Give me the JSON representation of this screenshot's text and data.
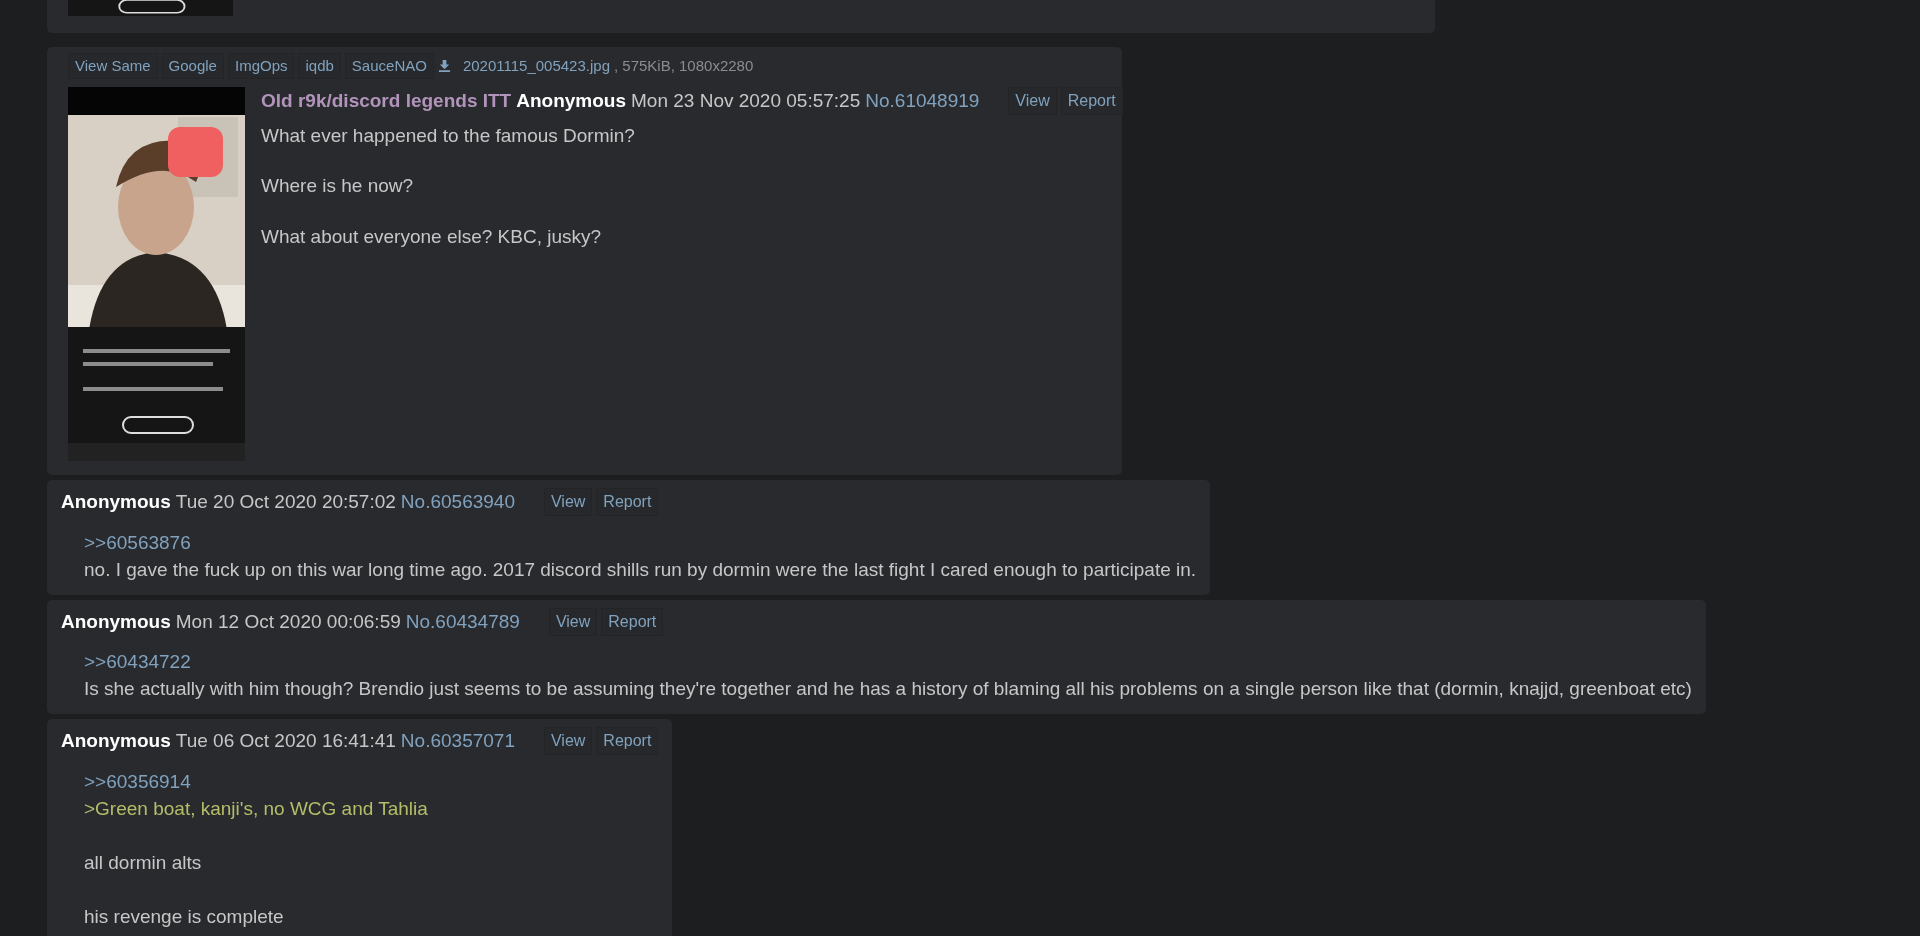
{
  "partial_post": {
    "thumbnail": {
      "kind": "picture"
    }
  },
  "op_post": {
    "image_links": [
      "View Same",
      "Google",
      "ImgOps",
      "iqdb",
      "SauceNAO"
    ],
    "file_name": "20201115_005423.jpg",
    "file_meta": ", 575KiB, 1080x2280",
    "thumbnail": {
      "kind": "picture"
    },
    "subject": "Old r9k/discord legends ITT",
    "name": "Anonymous",
    "date": "Mon 23 Nov 2020 05:57:25",
    "number": "No.61048919",
    "buttons": [
      "View",
      "Report"
    ],
    "paragraphs": [
      {
        "lines": [
          {
            "kind": "text",
            "text": "What ever happened to the famous Dormin?"
          }
        ]
      },
      {
        "lines": [
          {
            "kind": "text",
            "text": "Where is he now?"
          }
        ]
      },
      {
        "lines": [
          {
            "kind": "text",
            "text": "What about everyone else? KBC, jusky?"
          }
        ]
      }
    ]
  },
  "replies": [
    {
      "name": "Anonymous",
      "date": "Tue 20 Oct 2020 20:57:02",
      "number": "No.60563940",
      "buttons": [
        "View",
        "Report"
      ],
      "paragraphs": [
        {
          "lines": [
            {
              "kind": "quotelink",
              "text": ">>60563876"
            },
            {
              "kind": "text",
              "text": "no. I gave the fuck up on this war long time ago. 2017 discord shills run by dormin were the last fight I cared enough to participate in."
            }
          ]
        }
      ]
    },
    {
      "name": "Anonymous",
      "date": "Mon 12 Oct 2020 00:06:59",
      "number": "No.60434789",
      "buttons": [
        "View",
        "Report"
      ],
      "paragraphs": [
        {
          "lines": [
            {
              "kind": "quotelink",
              "text": ">>60434722"
            },
            {
              "kind": "text",
              "text": "Is she actually with him though? Brendio just seems to be assuming they're together and he has a history of blaming all his problems on a single person like that (dormin, knajjd, greenboat etc)"
            }
          ]
        }
      ]
    },
    {
      "name": "Anonymous",
      "date": "Tue 06 Oct 2020 16:41:41",
      "number": "No.60357071",
      "buttons": [
        "View",
        "Report"
      ],
      "paragraphs": [
        {
          "lines": [
            {
              "kind": "quotelink",
              "text": ">>60356914"
            },
            {
              "kind": "greentext",
              "text": ">Green boat, kanji's, no WCG and Tahlia"
            }
          ]
        },
        {
          "lines": [
            {
              "kind": "text",
              "text": "all dormin alts"
            }
          ]
        },
        {
          "lines": [
            {
              "kind": "text",
              "text": "his revenge is complete"
            }
          ]
        }
      ]
    }
  ]
}
